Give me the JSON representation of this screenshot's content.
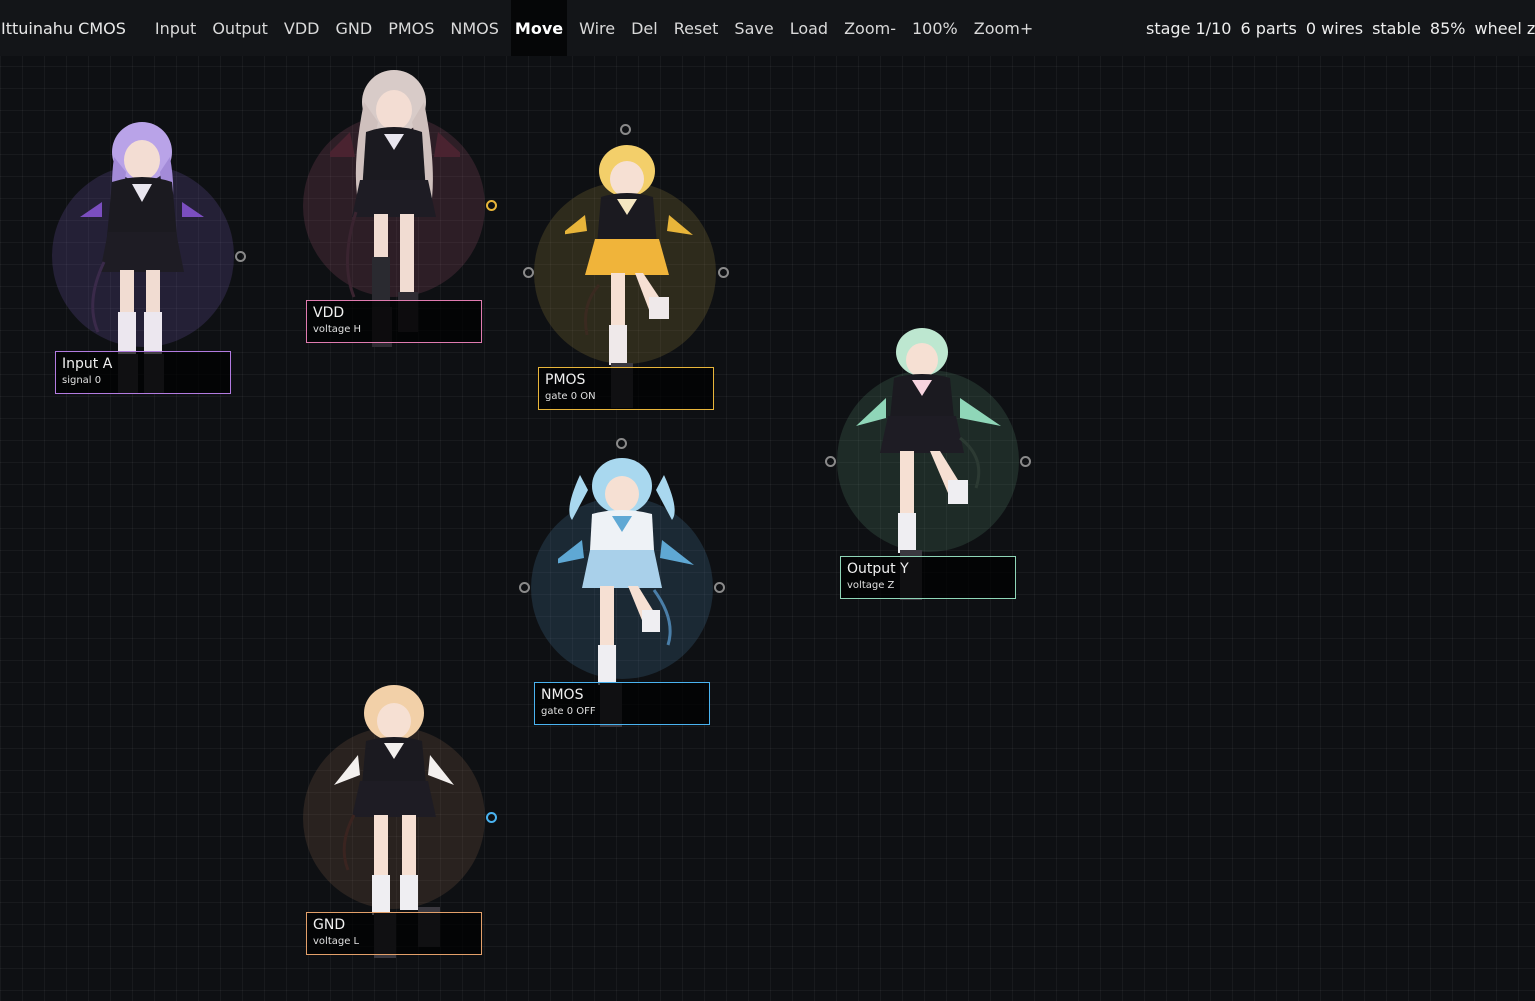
{
  "app": {
    "title": "Ittuinahu CMOS"
  },
  "menu": [
    {
      "id": "input",
      "label": "Input"
    },
    {
      "id": "output",
      "label": "Output"
    },
    {
      "id": "vdd",
      "label": "VDD"
    },
    {
      "id": "gnd",
      "label": "GND"
    },
    {
      "id": "pmos",
      "label": "PMOS"
    },
    {
      "id": "nmos",
      "label": "NMOS"
    },
    {
      "id": "move",
      "label": "Move",
      "active": true
    },
    {
      "id": "wire",
      "label": "Wire"
    },
    {
      "id": "del",
      "label": "Del"
    },
    {
      "id": "reset",
      "label": "Reset"
    },
    {
      "id": "save",
      "label": "Save"
    },
    {
      "id": "load",
      "label": "Load"
    },
    {
      "id": "zoom-out",
      "label": "Zoom-"
    },
    {
      "id": "zoom-level",
      "label": "100%"
    },
    {
      "id": "zoom-in",
      "label": "Zoom+"
    }
  ],
  "status": {
    "stage": "stage 1/10",
    "parts": "6 parts",
    "wires": "0 wires",
    "state": "stable",
    "percent": "85%",
    "hint": "wheel zoom"
  },
  "parts": [
    {
      "id": "input-a",
      "name": "Input A",
      "sub": "signal 0",
      "color": "#b27be0",
      "hair": "#b9a3e8"
    },
    {
      "id": "vdd",
      "name": "VDD",
      "sub": "voltage H",
      "color": "#e07bb0",
      "hair": "#d8cbc8"
    },
    {
      "id": "pmos",
      "name": "PMOS",
      "sub": "gate 0  ON",
      "color": "#e8b53a",
      "hair": "#f3cf6a"
    },
    {
      "id": "nmos",
      "name": "NMOS",
      "sub": "gate 0  OFF",
      "color": "#4ab3f0",
      "hair": "#a9d8ef"
    },
    {
      "id": "output-y",
      "name": "Output Y",
      "sub": "voltage Z",
      "color": "#8fd6b8",
      "hair": "#bde7d0"
    },
    {
      "id": "gnd",
      "name": "GND",
      "sub": "voltage L",
      "color": "#e3a06a",
      "hair": "#f2d0a8"
    }
  ]
}
